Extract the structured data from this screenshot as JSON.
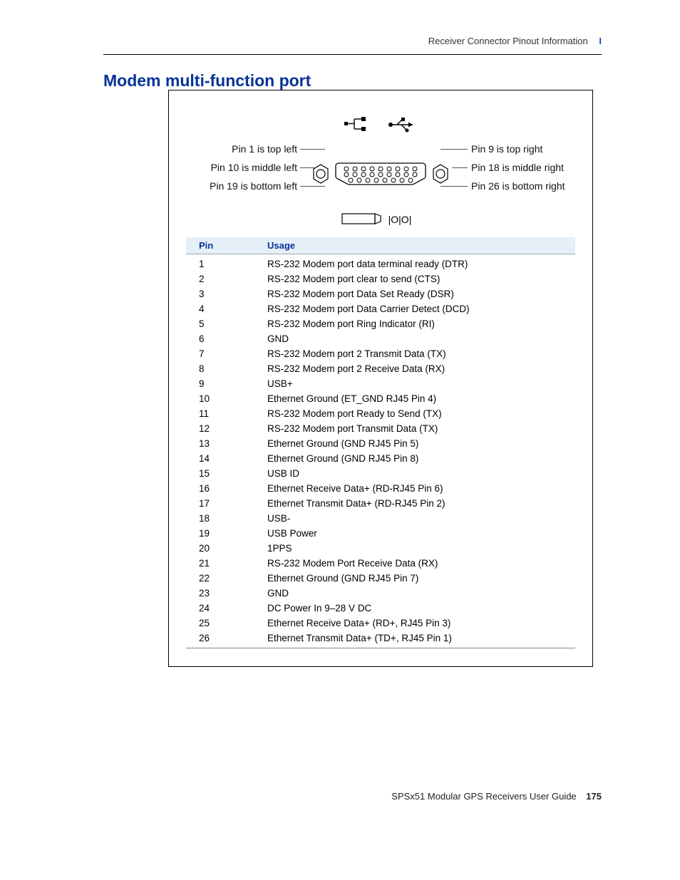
{
  "running_header": {
    "text": "Receiver Connector Pinout Information",
    "appendix": "I"
  },
  "section_title": "Modem multi-function port",
  "diagram": {
    "left_labels": [
      "Pin 1 is top left",
      "Pin 10 is middle left",
      "Pin 19 is bottom left"
    ],
    "right_labels": [
      "Pin 9 is top right",
      "Pin 18 is middle right",
      "Pin 26 is bottom right"
    ]
  },
  "table": {
    "headers": {
      "pin": "Pin",
      "usage": "Usage"
    },
    "rows": [
      {
        "pin": "1",
        "usage": "RS-232 Modem port data terminal ready (DTR)"
      },
      {
        "pin": "2",
        "usage": "RS-232 Modem port clear to send (CTS)"
      },
      {
        "pin": "3",
        "usage": "RS-232 Modem port Data Set Ready (DSR)"
      },
      {
        "pin": "4",
        "usage": "RS-232 Modem port Data Carrier Detect (DCD)"
      },
      {
        "pin": "5",
        "usage": "RS-232 Modem port Ring Indicator (RI)"
      },
      {
        "pin": "6",
        "usage": "GND"
      },
      {
        "pin": "7",
        "usage": "RS-232 Modem port 2 Transmit Data (TX)"
      },
      {
        "pin": "8",
        "usage": "RS-232 Modem port 2 Receive Data (RX)"
      },
      {
        "pin": "9",
        "usage": "USB+"
      },
      {
        "pin": "10",
        "usage": "Ethernet Ground (ET_GND RJ45 Pin 4)"
      },
      {
        "pin": "11",
        "usage": "RS-232 Modem port Ready to Send (TX)"
      },
      {
        "pin": "12",
        "usage": "RS-232 Modem port Transmit Data (TX)"
      },
      {
        "pin": "13",
        "usage": "Ethernet Ground (GND RJ45 Pin 5)"
      },
      {
        "pin": "14",
        "usage": "Ethernet Ground (GND RJ45 Pin 8)"
      },
      {
        "pin": "15",
        "usage": "USB ID"
      },
      {
        "pin": "16",
        "usage": "Ethernet Receive Data+ (RD-RJ45 Pin 6)"
      },
      {
        "pin": "17",
        "usage": "Ethernet Transmit Data+ (RD-RJ45 Pin 2)"
      },
      {
        "pin": "18",
        "usage": "USB-"
      },
      {
        "pin": "19",
        "usage": "USB Power"
      },
      {
        "pin": "20",
        "usage": "1PPS"
      },
      {
        "pin": "21",
        "usage": "RS-232 Modem Port Receive Data (RX)"
      },
      {
        "pin": "22",
        "usage": "Ethernet Ground (GND RJ45 Pin 7)"
      },
      {
        "pin": "23",
        "usage": "GND"
      },
      {
        "pin": "24",
        "usage": "DC Power In 9–28 V DC"
      },
      {
        "pin": "25",
        "usage": "Ethernet Receive Data+ (RD+, RJ45 Pin 3)"
      },
      {
        "pin": "26",
        "usage": "Ethernet Transmit Data+ (TD+, RJ45 Pin 1)"
      }
    ]
  },
  "footer": {
    "doc": "SPSx51 Modular GPS Receivers User Guide",
    "page": "175"
  }
}
